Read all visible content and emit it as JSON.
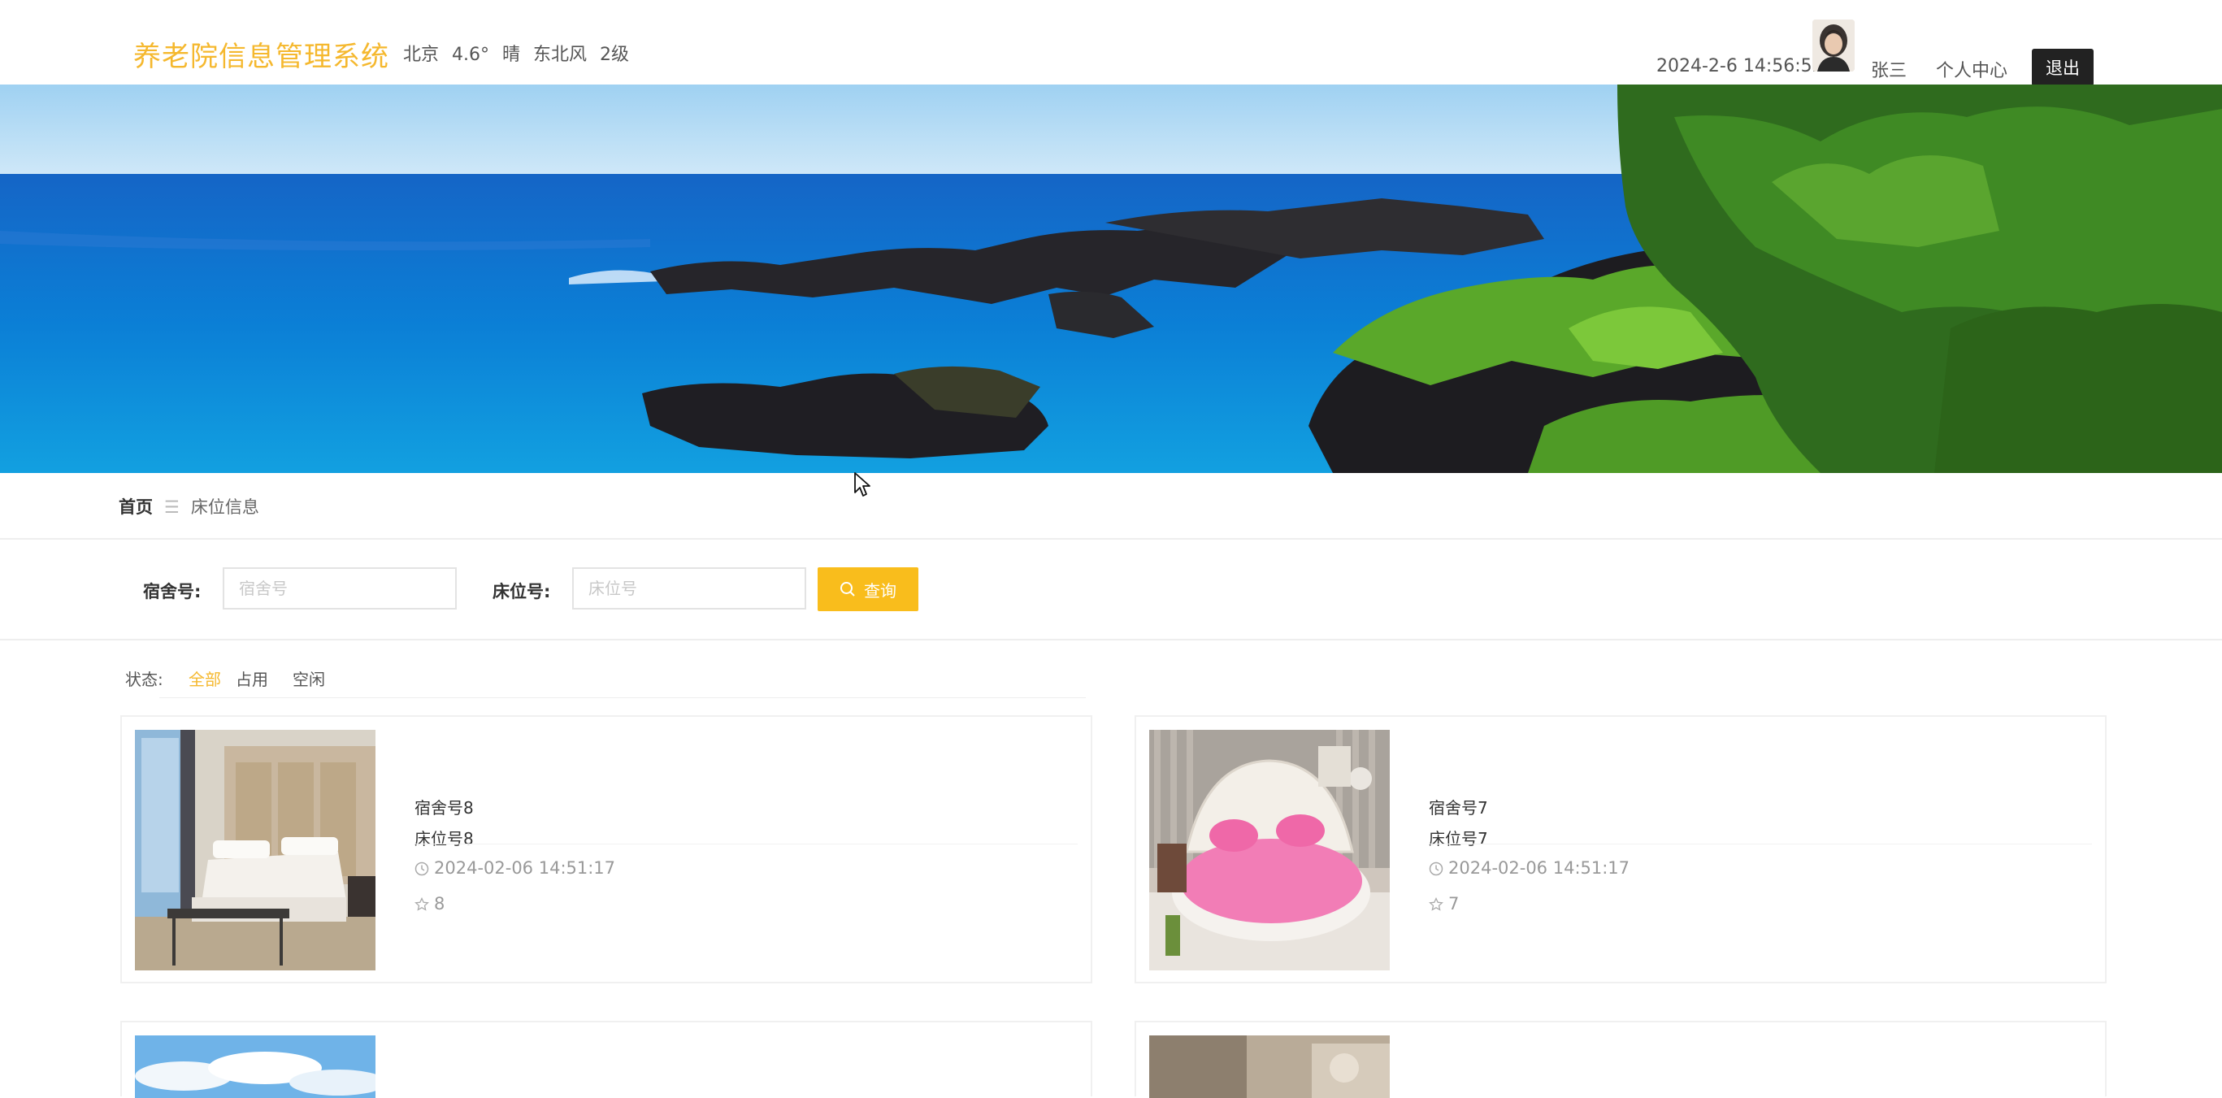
{
  "header": {
    "app_title": "养老院信息管理系统",
    "weather": {
      "city": "北京",
      "temp": "4.6°",
      "condition": "晴",
      "wind": "东北风",
      "level": "2级"
    },
    "datetime": "2024-2-6 14:56:52",
    "username": "张三",
    "personal_center": "个人中心",
    "logout": "退出"
  },
  "banner": {
    "slide_count": 3,
    "active_slide": 1
  },
  "breadcrumb": {
    "home": "首页",
    "separator": "☰",
    "current": "床位信息"
  },
  "search": {
    "dorm_label": "宿舍号:",
    "dorm_placeholder": "宿舍号",
    "bed_label": "床位号:",
    "bed_placeholder": "床位号",
    "query_button": "查询"
  },
  "filter": {
    "label": "状态:",
    "options": [
      "全部",
      "占用",
      "空闲"
    ],
    "active": "全部"
  },
  "cards": [
    {
      "dorm": "宿舍号8",
      "bed": "床位号8",
      "time": "2024-02-06 14:51:17",
      "likes": "8"
    },
    {
      "dorm": "宿舍号7",
      "bed": "床位号7",
      "time": "2024-02-06 14:51:17",
      "likes": "7"
    }
  ],
  "colors": {
    "accent": "#f5b82e",
    "button": "#f9bd1c",
    "logout_bg": "#222222"
  }
}
